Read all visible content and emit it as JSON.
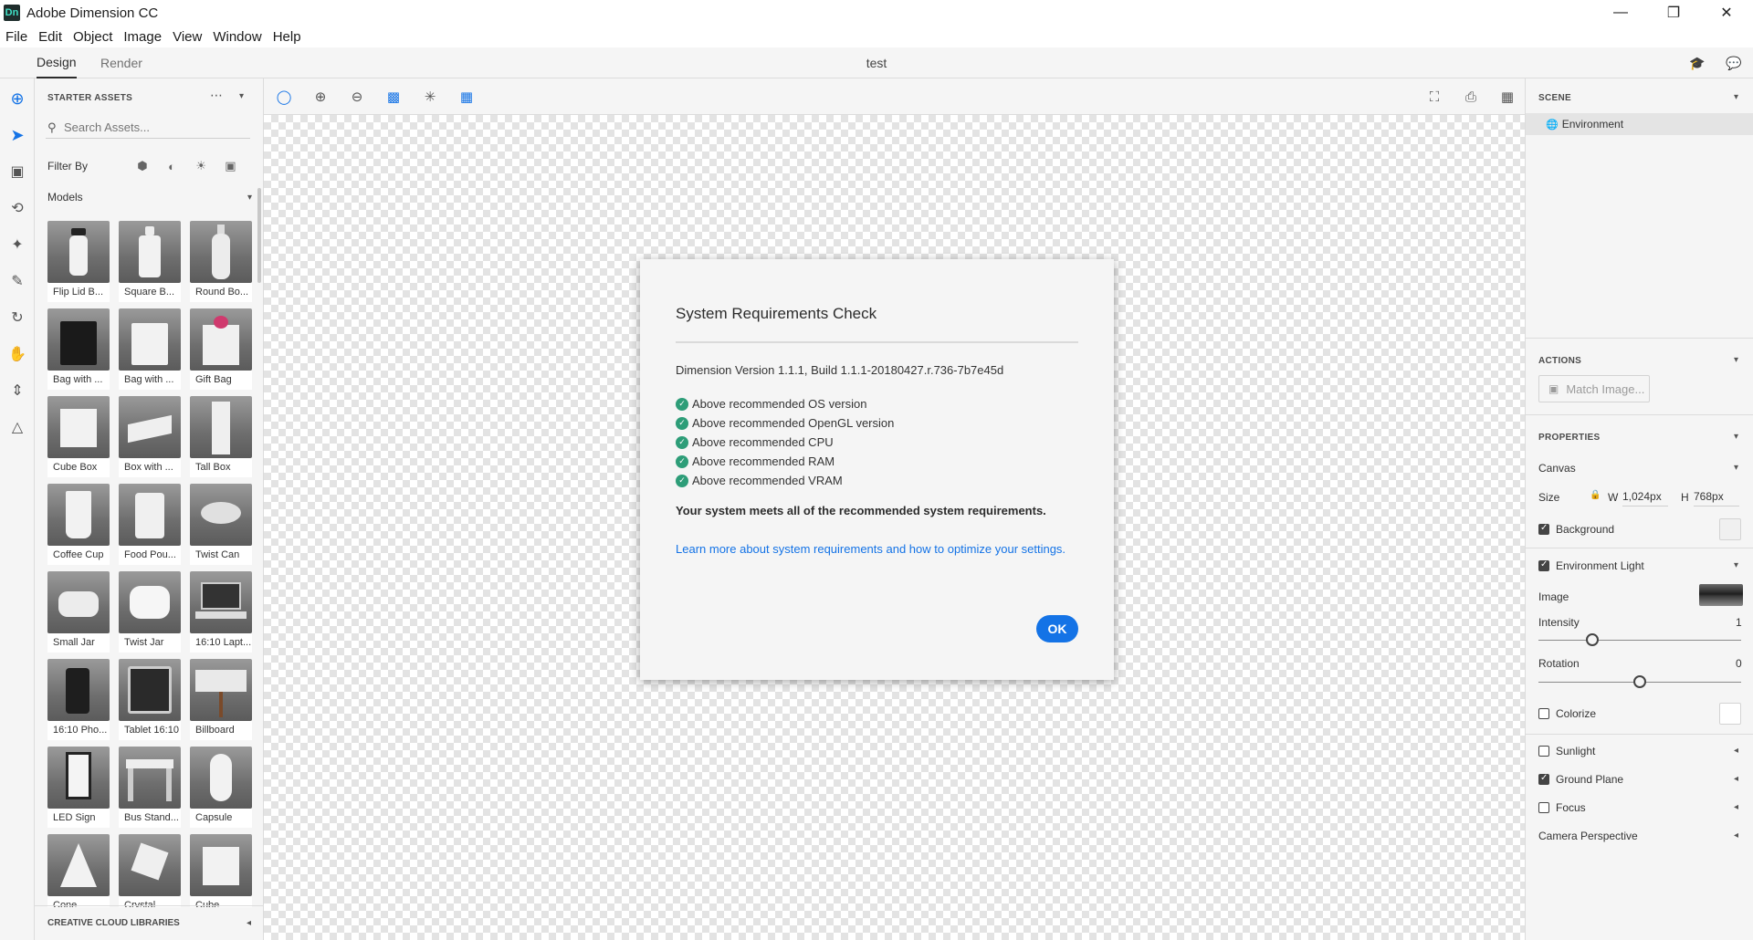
{
  "app": {
    "logo_text": "Dn",
    "title": "Adobe Dimension CC",
    "document_title": "test"
  },
  "window_controls": {
    "minimize": "—",
    "maximize": "❐",
    "close": "✕"
  },
  "menu": [
    "File",
    "Edit",
    "Object",
    "Image",
    "View",
    "Window",
    "Help"
  ],
  "tabs": {
    "design": "Design",
    "render": "Render"
  },
  "assets": {
    "header": "STARTER ASSETS",
    "search_placeholder": "Search Assets...",
    "filter_label": "Filter By",
    "section_label": "Models",
    "libraries_label": "CREATIVE CLOUD LIBRARIES",
    "models": [
      {
        "label": "Flip Lid B...",
        "shape": "bottle-dark"
      },
      {
        "label": "Square B...",
        "shape": "bottle"
      },
      {
        "label": "Round Bo...",
        "shape": "bottle-tall"
      },
      {
        "label": "Bag with ...",
        "shape": "bag-dark"
      },
      {
        "label": "Bag with ...",
        "shape": "bag"
      },
      {
        "label": "Gift Bag",
        "shape": "gift-bag"
      },
      {
        "label": "Cube Box",
        "shape": "cube"
      },
      {
        "label": "Box with ...",
        "shape": "flat-box"
      },
      {
        "label": "Tall Box",
        "shape": "tall-box"
      },
      {
        "label": "Coffee Cup",
        "shape": "cup"
      },
      {
        "label": "Food Pou...",
        "shape": "pouch"
      },
      {
        "label": "Twist Can",
        "shape": "can"
      },
      {
        "label": "Small Jar",
        "shape": "jar"
      },
      {
        "label": "Twist Jar",
        "shape": "jar-white"
      },
      {
        "label": "16:10 Lapt...",
        "shape": "laptop"
      },
      {
        "label": "16:10 Pho...",
        "shape": "phone"
      },
      {
        "label": "Tablet 16:10",
        "shape": "tablet"
      },
      {
        "label": "Billboard",
        "shape": "billboard"
      },
      {
        "label": "LED Sign",
        "shape": "led-sign"
      },
      {
        "label": "Bus Stand...",
        "shape": "bus-stand"
      },
      {
        "label": "Capsule",
        "shape": "capsule"
      },
      {
        "label": "Cone",
        "shape": "cone"
      },
      {
        "label": "Crystal",
        "shape": "crystal"
      },
      {
        "label": "Cube",
        "shape": "cube"
      }
    ]
  },
  "dialog": {
    "title": "System Requirements Check",
    "version": "Dimension Version 1.1.1, Build 1.1.1-20180427.r.736-7b7e45d",
    "checks": [
      "Above recommended OS version",
      "Above recommended OpenGL version",
      "Above recommended CPU",
      "Above recommended RAM",
      "Above recommended VRAM"
    ],
    "summary": "Your system meets all of the recommended system requirements.",
    "link": "Learn more about system requirements and how to optimize your settings.",
    "ok_label": "OK"
  },
  "right_panel": {
    "scene_header": "SCENE",
    "scene_item": "Environment",
    "actions_header": "ACTIONS",
    "match_image": "Match Image...",
    "properties_header": "PROPERTIES",
    "canvas_label": "Canvas",
    "size_label": "Size",
    "width_label": "W",
    "width_value": "1,024px",
    "height_label": "H",
    "height_value": "768px",
    "background_label": "Background",
    "background_checked": true,
    "env_light_label": "Environment Light",
    "env_light_checked": true,
    "image_label": "Image",
    "intensity_label": "Intensity",
    "intensity_value": "1",
    "rotation_label": "Rotation",
    "rotation_value": "0",
    "colorize_label": "Colorize",
    "colorize_checked": false,
    "sunlight_label": "Sunlight",
    "sunlight_checked": false,
    "ground_plane_label": "Ground Plane",
    "ground_plane_checked": true,
    "focus_label": "Focus",
    "focus_checked": false,
    "camera_perspective_label": "Camera Perspective"
  },
  "colors": {
    "accent": "#1473e6",
    "check": "#2d9d78"
  }
}
